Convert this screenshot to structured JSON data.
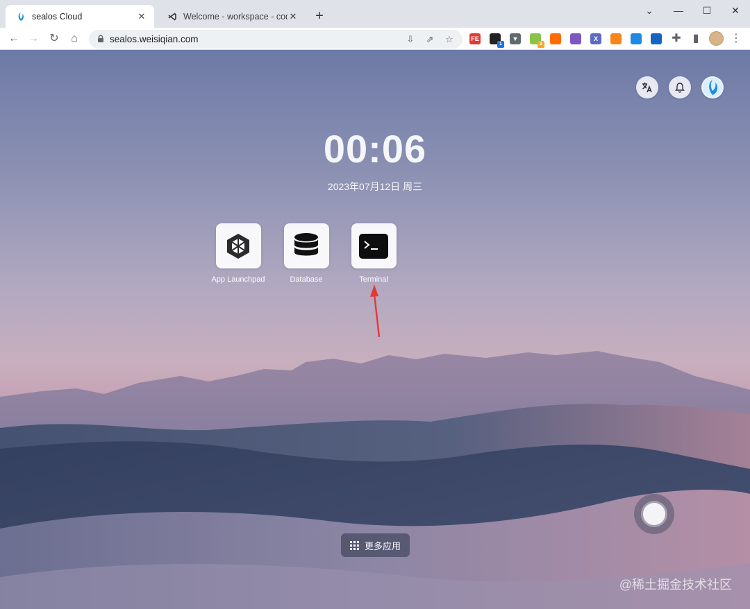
{
  "browser": {
    "tabs": [
      {
        "title": "sealos Cloud",
        "active": true
      },
      {
        "title": "Welcome - workspace - code-",
        "active": false
      }
    ],
    "new_tab_label": "+",
    "url": "sealos.weisiqian.com",
    "window_controls": {
      "minimize": "—",
      "maximize": "☐",
      "close": "✕",
      "tab_search": "⌄"
    },
    "extensions": [
      {
        "name": "fe-extension",
        "label": "FE",
        "color": "#e53935"
      },
      {
        "name": "dark-extension",
        "label": "",
        "color": "#222222",
        "badge": "1",
        "badge_color": "#1a73e8"
      },
      {
        "name": "vue-extension",
        "label": "▼",
        "color": "#5f6b6d"
      },
      {
        "name": "green-extension",
        "label": "",
        "color": "#8bc34a",
        "badge": "2",
        "badge_color": "#f9a825"
      },
      {
        "name": "orange-extension",
        "label": "",
        "color": "#ff6d00"
      },
      {
        "name": "purple-extension",
        "label": "",
        "color": "#7e57c2"
      },
      {
        "name": "x-extension",
        "label": "X",
        "color": "#5c6bc0"
      },
      {
        "name": "metamask-extension",
        "label": "",
        "color": "#f6851b"
      },
      {
        "name": "blue-extension",
        "label": "",
        "color": "#1e88e5"
      },
      {
        "name": "meet-extension",
        "label": "",
        "color": "#1565c0"
      }
    ]
  },
  "desktop": {
    "clock": "00:06",
    "date": "2023年07月12日 周三",
    "apps": [
      {
        "label": "App Launchpad",
        "icon": "hexagon-icon"
      },
      {
        "label": "Database",
        "icon": "database-icon"
      },
      {
        "label": "Terminal",
        "icon": "terminal-icon"
      }
    ],
    "more_apps_label": "更多应用",
    "watermark": "@稀土掘金技术社区",
    "annotation_color": "#e53935"
  }
}
